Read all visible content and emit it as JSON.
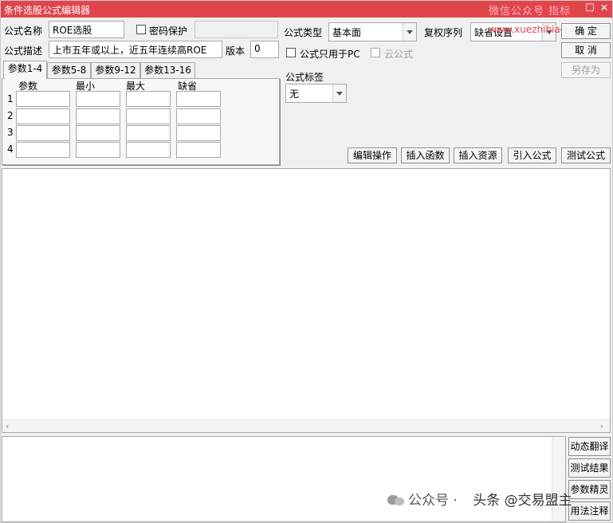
{
  "window": {
    "title": "条件选股公式编辑器",
    "titlebar_watermark": "微信公众号 指标",
    "restore_glyph": "☐",
    "close_glyph": "✕",
    "accent_color": "#e0454c"
  },
  "form": {
    "name_label": "公式名称",
    "name_value": "ROE选股",
    "password_label": "密码保护",
    "desc_label": "公式描述",
    "desc_value": "上市五年或以上，近五年连续高ROE",
    "version_label": "版本",
    "version_value": "0",
    "type_label": "公式类型",
    "type_value": "基本面",
    "rights_label": "复权序列",
    "rights_value": "缺省设置",
    "pc_only_label": "公式只用于PC",
    "cloud_label": "云公式",
    "tag_label": "公式标签",
    "tag_value": "无",
    "site_watermark": "www.xuezhibiao.com"
  },
  "buttons": {
    "confirm": "确  定",
    "cancel": "取  消",
    "save_as": "另存为",
    "edit_ops": "编辑操作",
    "insert_func": "插入函数",
    "insert_res": "插入资源",
    "import_formula": "引入公式",
    "test_formula": "测试公式"
  },
  "tabs": [
    "参数1-4",
    "参数5-8",
    "参数9-12",
    "参数13-16"
  ],
  "params": {
    "headers": [
      "参数",
      "最小",
      "最大",
      "缺省"
    ],
    "rows": [
      "1",
      "2",
      "3",
      "4"
    ]
  },
  "side_buttons": [
    "动态翻译",
    "测试结果",
    "参数精灵",
    "用法注释"
  ],
  "editor": {
    "scroll_left": "‹",
    "scroll_right": "›"
  },
  "watermark": {
    "left": "公众号 · ",
    "right": "头条 @交易盟主"
  }
}
